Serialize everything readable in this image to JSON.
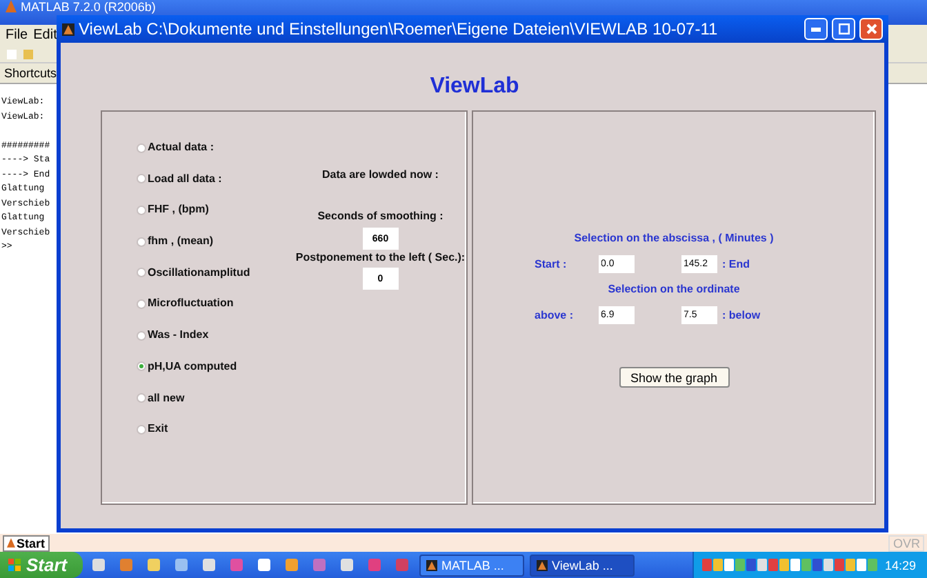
{
  "matlab": {
    "title": "MATLAB 7.2.0 (R2006b)",
    "menu": [
      "File",
      "Edit"
    ],
    "shortcuts": "Shortcuts",
    "command_lines": [
      "ViewLab:",
      "ViewLab:",
      "#########",
      "----> Sta",
      "----> End",
      "Glattung",
      "Verschieb",
      "Glattung",
      "Verschieb",
      ">>"
    ],
    "start_button": "Start",
    "status": "OVR"
  },
  "viewlab": {
    "title": "ViewLab  C:\\Dokumente und Einstellungen\\Roemer\\Eigene Dateien\\VIEWLAB 10-07-11",
    "heading": "ViewLab",
    "options": [
      {
        "label": "Actual data :",
        "selected": false
      },
      {
        "label": "Load all data :",
        "selected": false
      },
      {
        "label": "FHF , (bpm)",
        "selected": false
      },
      {
        "label": "fhm , (mean)",
        "selected": false
      },
      {
        "label": "Oscillationamplitud",
        "selected": false
      },
      {
        "label": "Microfluctuation",
        "selected": false
      },
      {
        "label": "Was - Index",
        "selected": false
      },
      {
        "label": "pH,UA computed",
        "selected": true
      },
      {
        "label": "all new",
        "selected": false
      },
      {
        "label": "Exit",
        "selected": false
      }
    ],
    "loaded_label": "Data are lowded now :",
    "smoothing_label": "Seconds of smoothing :",
    "smoothing_value": "660",
    "postponement_label": "Postponement to the left ( Sec.):",
    "postponement_value": "0",
    "abscissa_label": "Selection on the abscissa , ( Minutes )",
    "start_label": "Start :",
    "start_value": "0.0",
    "end_value": "145.2",
    "end_label": ": End",
    "ordinate_label": "Selection on the ordinate",
    "above_label": "above :",
    "above_value": "6.9",
    "below_value": "7.5",
    "below_label": ": below",
    "button": "Show the graph"
  },
  "taskbar": {
    "start": "Start",
    "tasks": [
      {
        "label": "MATLAB ...",
        "selected": false
      },
      {
        "label": "ViewLab ...",
        "selected": true
      }
    ],
    "clock": "14:29"
  }
}
